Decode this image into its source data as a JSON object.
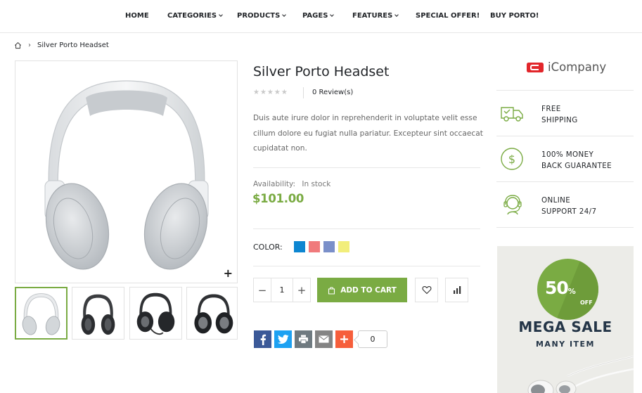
{
  "nav": {
    "home": "HOME",
    "categories": "CATEGORIES",
    "products": "PRODUCTS",
    "pages": "PAGES",
    "features": "FEATURES",
    "special_offer": "SPECIAL OFFER!",
    "buy": "BUY PORTO!"
  },
  "breadcrumb": {
    "current": "Silver Porto Headset",
    "separator": "›"
  },
  "product": {
    "title": "Silver Porto Headset",
    "stars": "★★★★★",
    "reviews": "0 Review(s)",
    "description": "Duis aute irure dolor in reprehenderit in voluptate velit esse cillum dolore eu fugiat nulla pariatur. Excepteur sint occaecat cupidatat non.",
    "availability_label": "Availability:",
    "availability_value": "In stock",
    "price": "$101.00",
    "color_label": "COLOR:",
    "swatches": [
      "#0d86d1",
      "#f07a7c",
      "#7a8fc9",
      "#f2ee7b"
    ],
    "quantity": "1",
    "add_to_cart": "ADD TO CART",
    "zoom": "+"
  },
  "share": {
    "count": "0",
    "icons": [
      "facebook-icon",
      "twitter-icon",
      "print-icon",
      "email-icon",
      "more-icon"
    ],
    "colors": [
      "#3b5998",
      "#1da1f2",
      "#6f7a80",
      "#848484",
      "#f65e3b"
    ]
  },
  "sidebar": {
    "brand": "iCompany",
    "features": [
      {
        "line1": "FREE",
        "line2": "SHIPPING",
        "icon": "truck-icon"
      },
      {
        "line1": "100% MONEY",
        "line2": "BACK GUARANTEE",
        "icon": "dollar-icon"
      },
      {
        "line1": "ONLINE",
        "line2": "SUPPORT 24/7",
        "icon": "support-icon"
      }
    ],
    "banner": {
      "percent": "50",
      "percent_sign": "%",
      "off": "OFF",
      "title": "MEGA SALE",
      "subtitle": "MANY ITEM"
    }
  },
  "colors": {
    "accent": "#7aab43",
    "text": "#222529",
    "muted": "#666666"
  }
}
